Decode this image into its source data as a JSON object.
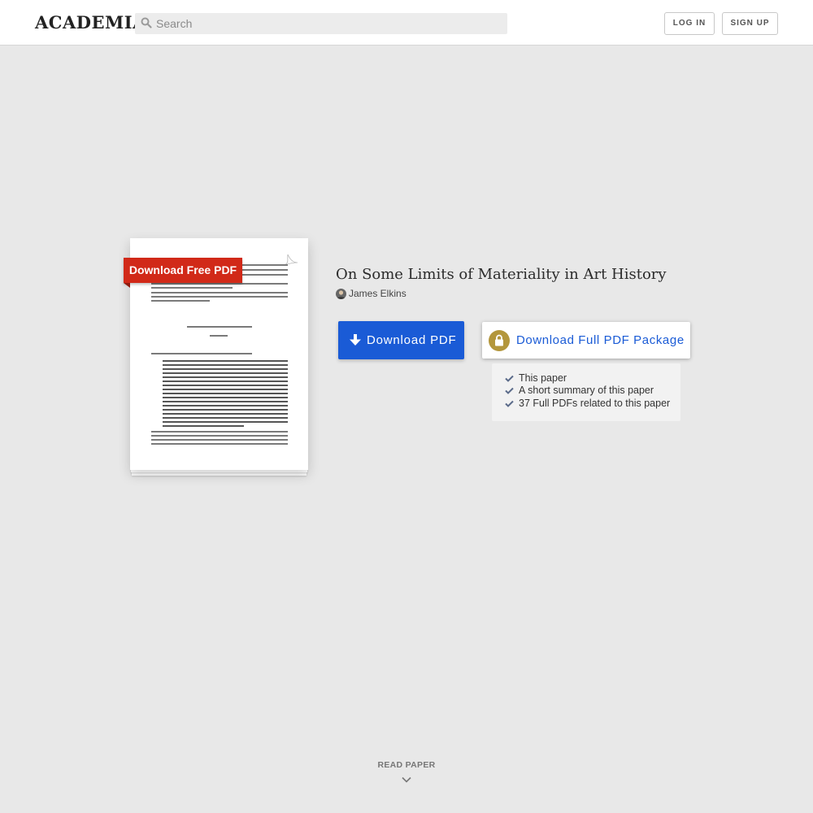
{
  "header": {
    "logo": "ACADEMIA",
    "search_placeholder": "Search",
    "login_label": "LOG IN",
    "signup_label": "SIGN UP"
  },
  "preview": {
    "ribbon_label": "Download Free PDF"
  },
  "paper": {
    "title": "On Some Limits of Materiality in Art History",
    "author": "James Elkins"
  },
  "actions": {
    "download_pdf_label": "Download PDF",
    "download_package_label": "Download Full PDF Package"
  },
  "package_features": [
    "This paper",
    "A short summary of this paper",
    "37 Full PDFs related to this paper"
  ],
  "footer": {
    "read_paper_label": "READ PAPER"
  },
  "colors": {
    "primary_blue": "#1a5bd6",
    "ribbon_red": "#d12918",
    "lock_gold": "#b3963b",
    "background": "#e8e8e8"
  }
}
